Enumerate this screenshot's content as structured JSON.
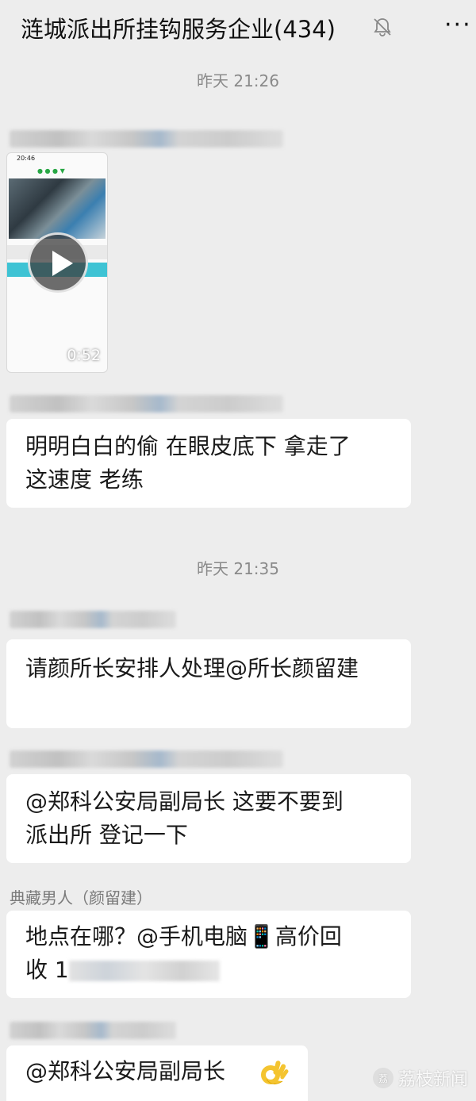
{
  "header": {
    "title": "涟城派出所挂钩服务企业(434)",
    "mute_icon": "bell-slash-icon",
    "more_icon": "more-horizontal-icon",
    "more_label": "···"
  },
  "messages": {
    "timestamp_1": "昨天 21:26",
    "video": {
      "duration": "0:52",
      "status_time": "20:46",
      "play_icon": "play-icon"
    },
    "msg_1": {
      "line1": "明明白白的偷 在眼皮底下 拿走了",
      "line2": "这速度 老练"
    },
    "timestamp_2": "昨天 21:35",
    "msg_2": {
      "line1": "请颜所长安排人处理@所长颜留建"
    },
    "msg_3": {
      "line1": "@郑科公安局副局长  这要不要到",
      "line2": "派出所 登记一下"
    },
    "sender_4": "典藏男人（颜留建）",
    "msg_4": {
      "line1": "地点在哪？@手机电脑📱高价回",
      "line2_prefix": "收 1"
    },
    "msg_5": {
      "text": "@郑科公安局副局长",
      "emoji": "👌"
    }
  },
  "watermark": {
    "logo_text": "荔",
    "text": "荔枝新闻"
  },
  "colors": {
    "background": "#ededed",
    "bubble": "#ffffff",
    "timestamp": "#8a8a8a",
    "sender": "#7a7a7a"
  }
}
